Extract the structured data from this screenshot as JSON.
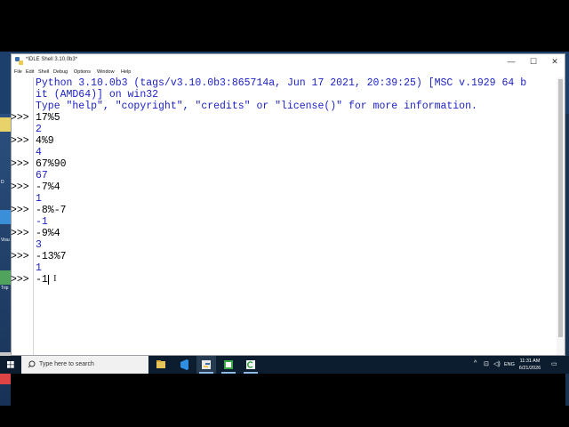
{
  "window": {
    "title": "*IDLE Shell 3.10.0b3*",
    "controls": {
      "minimize": "—",
      "maximize": "☐",
      "close": "✕"
    }
  },
  "menu": [
    "File",
    "Edit",
    "Shell",
    "Debug",
    "Options",
    "Window",
    "Help"
  ],
  "shell": {
    "banner": [
      "Python 3.10.0b3 (tags/v3.10.0b3:865714a, Jun 17 2021, 20:39:25) [MSC v.1929 64 b",
      "it (AMD64)] on win32",
      "Type \"help\", \"copyright\", \"credits\" or \"license()\" for more information."
    ],
    "prompt": ">>>",
    "session": [
      {
        "input": "17%5",
        "output": "2"
      },
      {
        "input": "4%9",
        "output": "4"
      },
      {
        "input": "67%90",
        "output": "67"
      },
      {
        "input": "-7%4",
        "output": "1"
      },
      {
        "input": "-8%-7",
        "output": "-1"
      },
      {
        "input": "-9%4",
        "output": "3"
      },
      {
        "input": "-13%7",
        "output": "1"
      }
    ],
    "current_input": "-1"
  },
  "taskbar": {
    "search_placeholder": "Type here to search",
    "apps": [
      "file-explorer-icon",
      "vscode-icon",
      "idle-shell-icon",
      "camtasia-icon",
      "camtasia-recorder-icon"
    ],
    "tray": {
      "chevron": "^",
      "network": "⊡",
      "volume": "◁)",
      "ime": "ENG"
    },
    "clock_time": "11:31 AM",
    "clock_date": "6/21/2026",
    "notification": "▭"
  },
  "desktop_labels": [
    "D",
    "Visu",
    "Trip"
  ],
  "colors": {
    "output": "#1e22c6",
    "input": "#000000",
    "taskbar": "#0c1d2f"
  }
}
